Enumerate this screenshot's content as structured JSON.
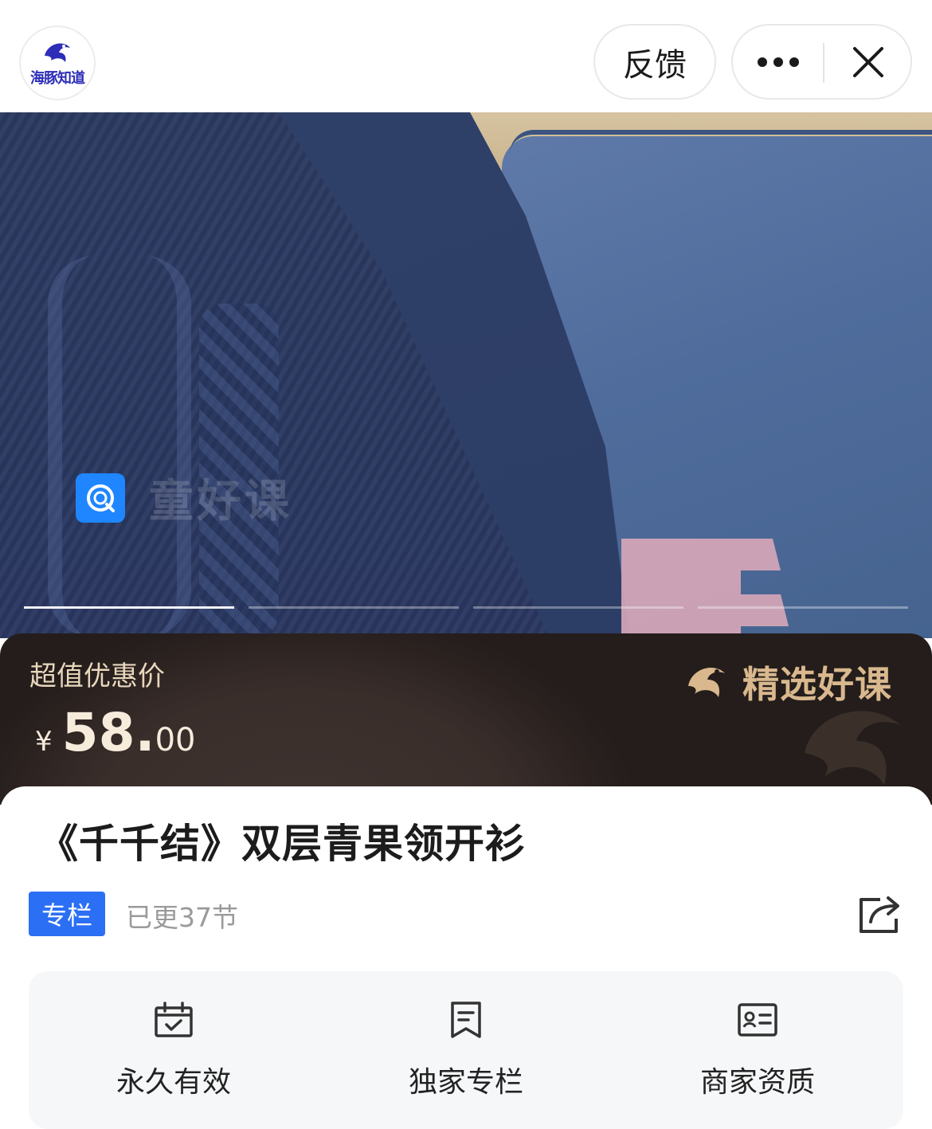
{
  "header": {
    "logo_text": "海豚知道",
    "feedback_label": "反馈",
    "more_icon": "more-dots-icon",
    "close_icon": "close-icon"
  },
  "banner": {
    "watermark_text": "童好课",
    "slides": 4,
    "active_slide": 1
  },
  "price_panel": {
    "label": "超值优惠价",
    "currency": "¥",
    "price_int": "58.",
    "price_dec": "00",
    "badge_text": "精选好课",
    "colors": {
      "panel_bg": "#241d1b",
      "gold": "#d9b88e"
    }
  },
  "course": {
    "title": "《千千结》双层青果领开衫",
    "tag": "专栏",
    "updated": "已更37节",
    "share_icon": "share-icon"
  },
  "features": [
    {
      "label": "永久有效",
      "icon": "calendar-check-icon"
    },
    {
      "label": "独家专栏",
      "icon": "document-icon"
    },
    {
      "label": "商家资质",
      "icon": "id-card-icon"
    }
  ],
  "colors": {
    "accent": "#2b6ff5"
  }
}
